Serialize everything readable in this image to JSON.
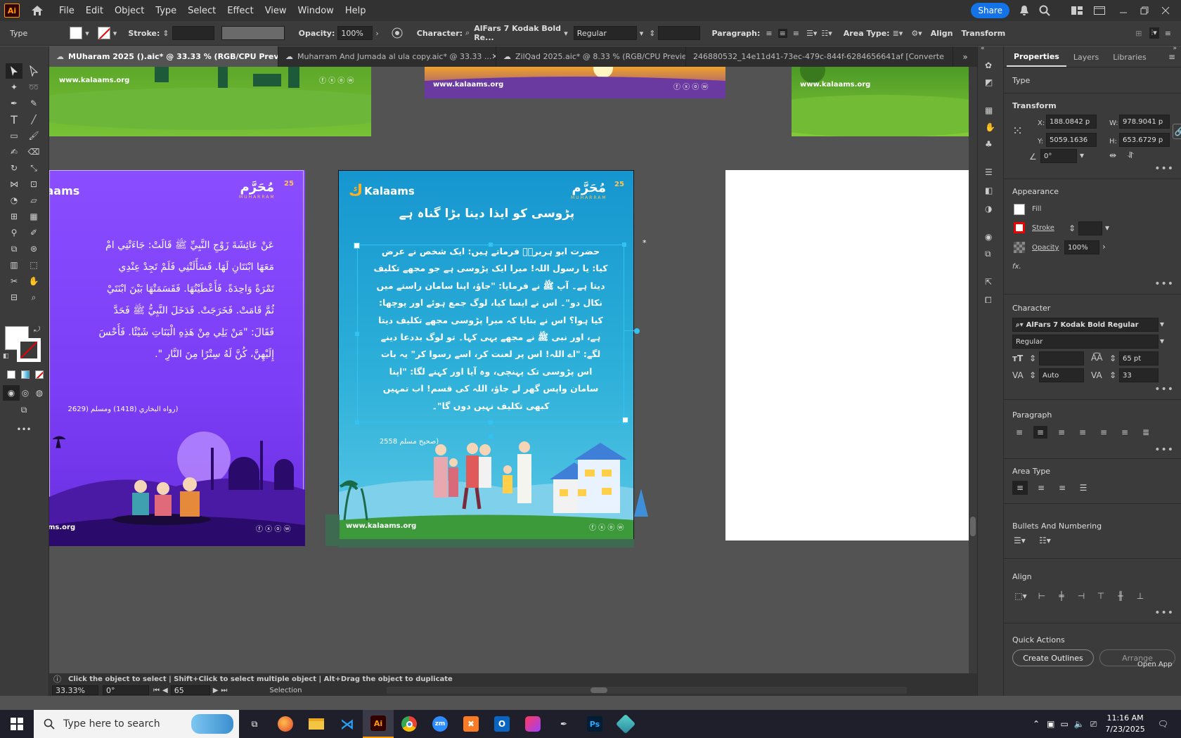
{
  "menubar": {
    "logo": "Ai",
    "items": [
      "File",
      "Edit",
      "Object",
      "Type",
      "Select",
      "Effect",
      "View",
      "Window",
      "Help"
    ],
    "share_label": "Share"
  },
  "controlbar": {
    "type_label": "Type",
    "stroke_label": "Stroke:",
    "opacity_label": "Opacity:",
    "opacity_value": "100%",
    "character_label": "Character:",
    "font_name": "AlFars 7 Kodak Bold Re...",
    "font_style": "Regular",
    "paragraph_label": "Paragraph:",
    "area_type_label": "Area Type:",
    "align_label": "Align",
    "transform_label": "Transform"
  },
  "tabs": [
    {
      "label": "MUharam 2025 ().aic* @ 33.33 % (RGB/CPU Preview)",
      "active": true
    },
    {
      "label": "Muharram And Jumada al ula copy.aic* @ 33.33 ...",
      "active": false
    },
    {
      "label": "ZilQad 2025.aic* @ 8.33 % (RGB/CPU Previe...",
      "active": false
    },
    {
      "label": "246880532_14e11d41-73ec-479c-844f-6284656641af [Converte",
      "active": false
    }
  ],
  "panel": {
    "tabs": [
      "Properties",
      "Layers",
      "Libraries"
    ],
    "type_heading": "Type",
    "transform_heading": "Transform",
    "x_label": "X:",
    "x_value": "188.0842 p",
    "y_label": "Y:",
    "y_value": "5059.1636",
    "w_label": "W:",
    "w_value": "978.9041 p",
    "h_label": "H:",
    "h_value": "653.6729 p",
    "angle_value": "0°",
    "appearance_heading": "Appearance",
    "fill_label": "Fill",
    "stroke_label": "Stroke",
    "opacity_label": "Opacity",
    "opacity_value": "100%",
    "fx_label": "fx.",
    "character_heading": "Character",
    "font_name": "AlFars 7 Kodak Bold Regular",
    "font_style": "Regular",
    "leading_value": "65 pt",
    "kerning_value": "Auto",
    "tracking_value": "33",
    "paragraph_heading": "Paragraph",
    "area_type_heading": "Area Type",
    "bullets_heading": "Bullets And Numbering",
    "align_heading": "Align",
    "quick_actions_heading": "Quick Actions",
    "create_outlines_label": "Create Outlines",
    "arrange_label": "Arrange",
    "open_app_label": "Open App"
  },
  "status": {
    "hint": "Click the object to select  |  Shift+Click to select multiple object  |  Alt+Drag the object to duplicate",
    "zoom": "33.33%",
    "rotation": "0°",
    "artboard": "65",
    "tool": "Selection"
  },
  "artboards": {
    "site": "www.kalaams.org",
    "brand": "Kalaams",
    "muharram_urdu": "مُحَرَّم",
    "muharram_latin": "MUHARRAM",
    "day_number": "25",
    "left_arabic_lines": [
      "عَنْ عَائِشَةَ زَوْجِ النَّبِيِّ ﷺ قَالَتْ: جَاءَتْنِي امْ",
      "مَعَهَا ابْنَتَانِ لَهَا. فَسَأَلَتْنِي فَلَمْ تَجِدْ عِنْدِي",
      "تَمْرَةً وَاحِدَةً. فَأَعْطَيْتُهَا. فَقَسَمَتْهَا بَيْنَ ابْنَتَيْ",
      "ثُمَّ قَامَتْ. فَخَرَجَتْ. فَدَخَلَ النَّبِيُّ ﷺ فَحَدَّ",
      "فَقَالَ: \"مَنْ يَلِي مِنْ هَذِهِ الْبَنَاتِ شَيْئًا. فَأَحْسَ",
      "إِلَيْهِنَّ، كُنَّ لَهُ سِتْرًا مِنَ النَّارِ \"."
    ],
    "left_reference": "(رواه البخاري (1418) ومسلم (2629",
    "center_title": "پڑوسی کو ایذا دینا بڑا گناہ ہے",
    "center_lines": [
      "حضرت ابو ہریرہؓ فرماتے ہیں: ایک شخص نے عرض",
      "کیا: یا رسول اللہ! میرا ایک پڑوسی ہے جو مجھے تکلیف",
      "دیتا ہے۔ آپ ﷺ نے فرمایا: \"جاؤ، اپنا سامان راستے میں",
      "نکال دو\"۔ اس نے ایسا کیا، لوگ جمع ہوئے اور پوچھا:",
      "کیا ہوا؟ اس نے بتایا کہ میرا پڑوسی مجھے تکلیف دیتا",
      "ہے، اور نبی ﷺ نے مجھے یہی کہا۔ تو لوگ بددعا دینے",
      "لگے: \"اے اللہ! اس پر لعنت کر، اسے رسوا کر\" یہ بات",
      "اس پڑوسی تک پہنچی، وہ آیا اور کہنے لگا: \"اپنا",
      "سامان واپس گھر لے جاؤ، اللہ کی قسم! اب تمہیں",
      "کبھی تکلیف نہیں دوں گا\"۔"
    ],
    "center_reference": "(صحیح مسلم 2558"
  },
  "taskbar": {
    "search_placeholder": "Type here to search",
    "time": "11:16 AM",
    "date": "7/23/2025"
  },
  "colors": {
    "accent": "#1473e6",
    "purple_top": "#8a4dff",
    "teal_top": "#1a9fd4",
    "selection": "#31c4f3"
  }
}
